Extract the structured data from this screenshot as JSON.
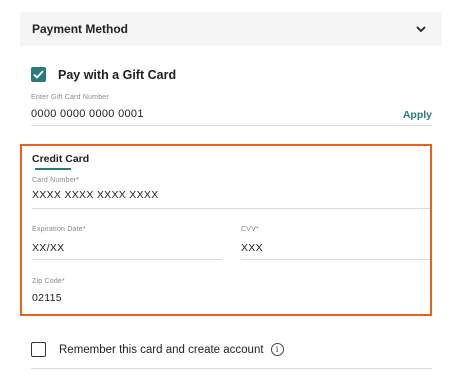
{
  "payment_section": {
    "title": "Payment Method",
    "toggle_icon": "chevron-down-icon"
  },
  "gift_card": {
    "checkbox_label": "Pay with a Gift Card",
    "checked": true,
    "field_label": "Enter Gift Card Number",
    "field_value": "0000 0000 0000 0001",
    "apply_label": "Apply"
  },
  "credit_card": {
    "tab_label": "Credit Card",
    "card_number": {
      "label": "Card Number*",
      "value": "XXXX XXXX XXXX XXXX"
    },
    "expiration_date": {
      "label": "Expiration Date*",
      "value": "XX/XX"
    },
    "cvv": {
      "label": "CVV*",
      "value": "XXX"
    },
    "zip_code": {
      "label": "Zip Code*",
      "value": "02115"
    }
  },
  "remember": {
    "checkbox_label": "Remember this card and create account",
    "checked": false,
    "info_icon": "info-icon"
  },
  "colors": {
    "accent": "#2a7a7e",
    "highlight_border": "#e8601c",
    "header_bg": "#f5f5f5"
  }
}
